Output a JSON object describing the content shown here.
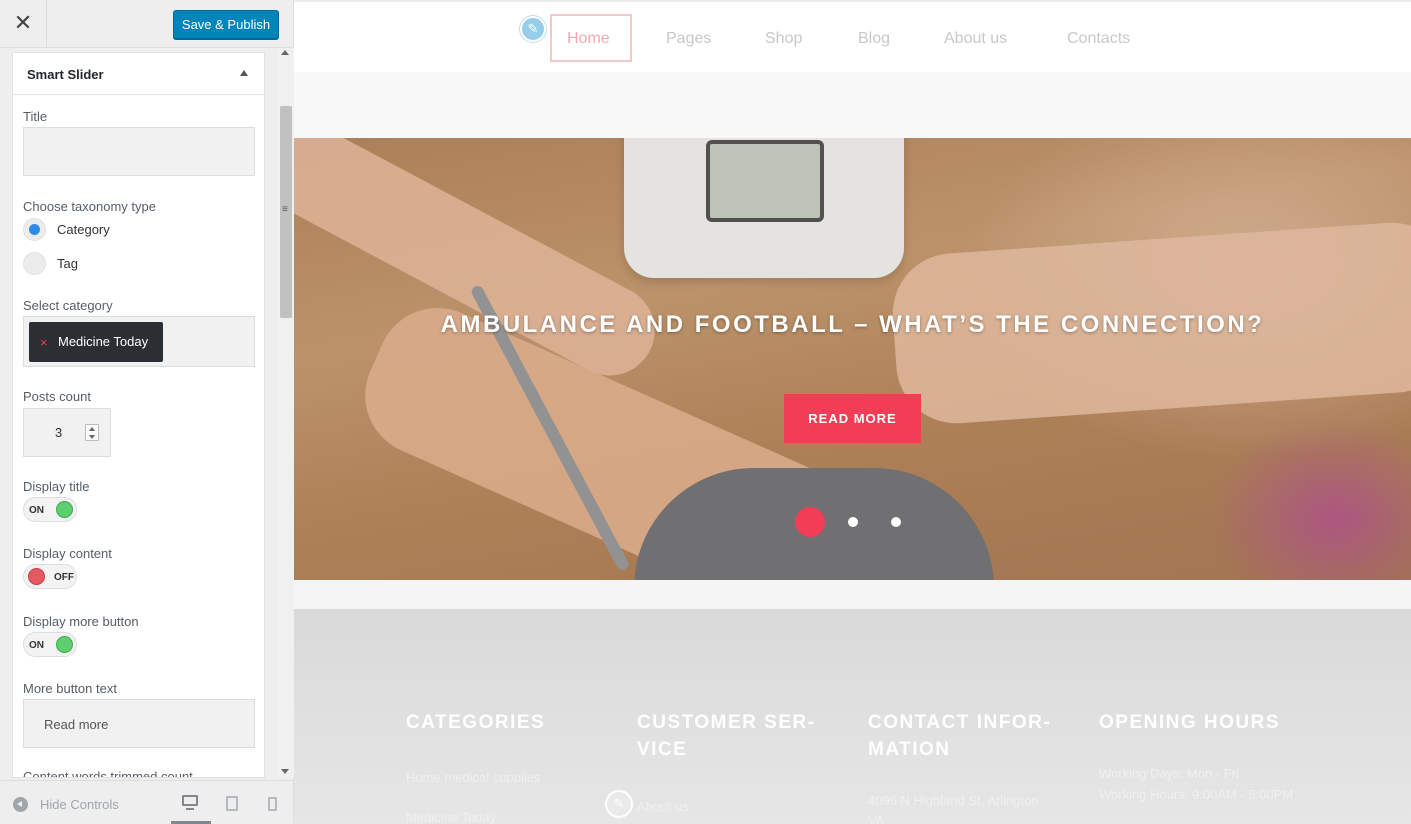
{
  "customizer": {
    "close_glyph": "✕",
    "save_label": "Save & Publish",
    "panel_title": "Smart Slider",
    "fields": {
      "title_label": "Title",
      "title_value": "",
      "taxonomy_label": "Choose taxonomy type",
      "taxonomy_options": [
        {
          "label": "Category",
          "selected": true
        },
        {
          "label": "Tag",
          "selected": false
        }
      ],
      "select_category_label": "Select category",
      "selected_category": "Medicine Today",
      "posts_count_label": "Posts count",
      "posts_count": "3",
      "display_title_label": "Display title",
      "display_title_state": "ON",
      "display_content_label": "Display content",
      "display_content_state": "OFF",
      "display_more_label": "Display more button",
      "display_more_state": "ON",
      "more_text_label": "More button text",
      "more_text_value": "Read more",
      "trimmed_label": "Content words trimmed count"
    },
    "footer": {
      "hide_controls": "Hide Controls"
    },
    "colors": {
      "save_button": "#0085ba",
      "radio_selected": "#2e8ce8",
      "toggle_on": "#5ccf6e",
      "toggle_off": "#e65862"
    }
  },
  "preview": {
    "nav": [
      "Home",
      "Pages",
      "Shop",
      "Blog",
      "About us",
      "Contacts"
    ],
    "active_nav": "Home",
    "hero": {
      "title": "AMBULANCE AND FOOTBALL – WHAT’S THE CONNECTION?",
      "button": "READ MORE",
      "slides_count": 3,
      "active_slide": 1
    },
    "footer": {
      "columns": [
        {
          "heading": "CATEGORIES",
          "lines": [
            "Home medical supplies",
            "Medicine Today"
          ]
        },
        {
          "heading": "CUSTOMER SER-VICE",
          "lines": [
            "About us"
          ]
        },
        {
          "heading": "CONTACT INFOR-MATION",
          "lines": [
            "4096 N Highland St, Arlington",
            "VA"
          ]
        },
        {
          "heading": "OPENING HOURS",
          "lines": [
            "Working Days: Mon - Fri",
            "Working Hours: 9:00AM - 5:00PM"
          ]
        }
      ]
    },
    "colors": {
      "accent": "#f23d56"
    }
  }
}
